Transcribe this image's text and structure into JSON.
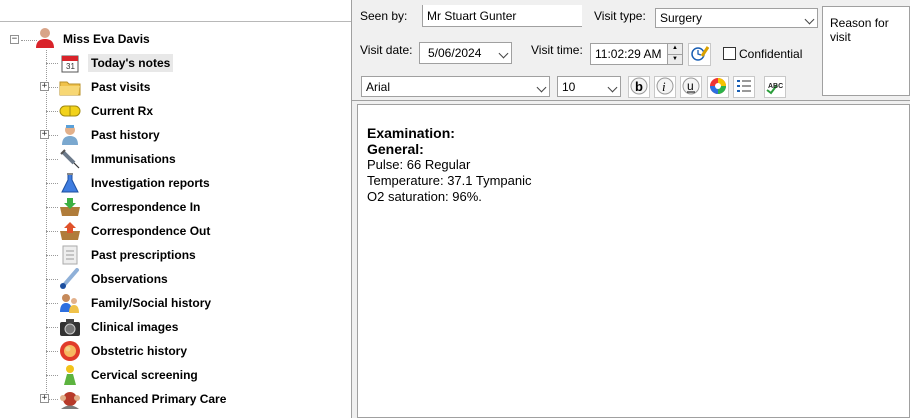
{
  "tree": {
    "patient_name": "Miss Eva Davis",
    "items": [
      {
        "label": "Today's notes",
        "icon": "calendar-icon",
        "expandable": false,
        "selected": true
      },
      {
        "label": "Past visits",
        "icon": "folder-icon",
        "expandable": true
      },
      {
        "label": "Current Rx",
        "icon": "pill-icon",
        "expandable": false
      },
      {
        "label": "Past history",
        "icon": "doctor-icon",
        "expandable": true
      },
      {
        "label": "Immunisations",
        "icon": "syringe-icon",
        "expandable": false
      },
      {
        "label": "Investigation reports",
        "icon": "flask-icon",
        "expandable": false
      },
      {
        "label": "Correspondence In",
        "icon": "inbox-icon",
        "expandable": false
      },
      {
        "label": "Correspondence Out",
        "icon": "outbox-icon",
        "expandable": false
      },
      {
        "label": "Past prescriptions",
        "icon": "prescription-icon",
        "expandable": false
      },
      {
        "label": "Observations",
        "icon": "thermometer-icon",
        "expandable": false
      },
      {
        "label": "Family/Social history",
        "icon": "family-icon",
        "expandable": false
      },
      {
        "label": "Clinical images",
        "icon": "camera-icon",
        "expandable": false
      },
      {
        "label": "Obstetric history",
        "icon": "fetus-icon",
        "expandable": false
      },
      {
        "label": "Cervical screening",
        "icon": "female-figure-icon",
        "expandable": false
      },
      {
        "label": "Enhanced Primary Care",
        "icon": "care-team-icon",
        "expandable": true
      }
    ]
  },
  "header": {
    "seen_by_label": "Seen by:",
    "seen_by_value": "Mr Stuart Gunter",
    "visit_type_label": "Visit type:",
    "visit_type_value": "Surgery",
    "reason_label": "Reason for visit",
    "visit_date_label": "Visit date:",
    "visit_date_value": "5/06/2024",
    "visit_time_label": "Visit time:",
    "visit_time_value": "11:02:29 AM",
    "confidential_label": "Confidential",
    "font_value": "Arial",
    "size_value": "10"
  },
  "notes": {
    "heading1": "Examination:",
    "heading2": "General:",
    "line1": "Pulse: 66 Regular",
    "line2": "Temperature: 37.1 Tympanic",
    "line3": "O2 saturation: 96%."
  }
}
